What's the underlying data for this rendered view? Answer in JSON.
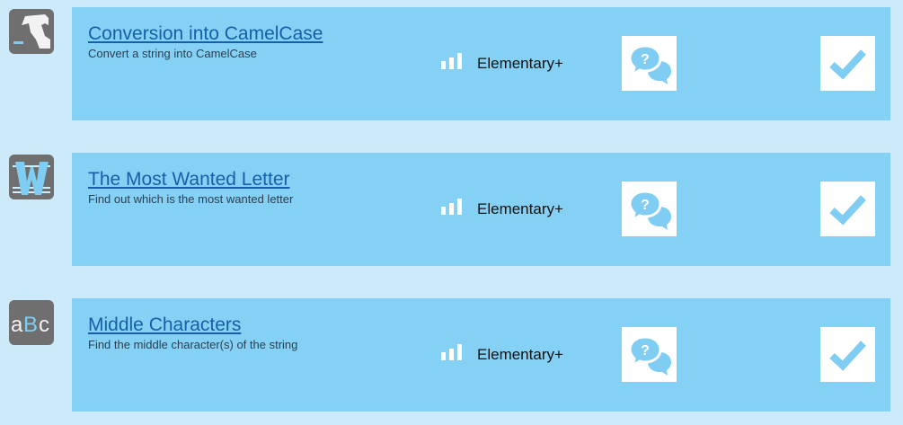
{
  "colors": {
    "page_bg": "#cdeafb",
    "card_bg": "#85d1f5",
    "title_link": "#1560a8",
    "icon_accent": "#7fcdf3"
  },
  "missions": [
    {
      "title": "Conversion into CamelCase",
      "description": "Convert a string into CamelCase",
      "level": "Elementary+",
      "icon": "camel-icon"
    },
    {
      "title": "The Most Wanted Letter",
      "description": "Find out which is the most wanted letter",
      "level": "Elementary+",
      "icon": "letter-w-icon"
    },
    {
      "title": "Middle Characters",
      "description": "Find the middle character(s) of the string",
      "level": "Elementary+",
      "icon": "abc-icon",
      "icon_text": [
        "a",
        "B",
        "c"
      ]
    }
  ]
}
